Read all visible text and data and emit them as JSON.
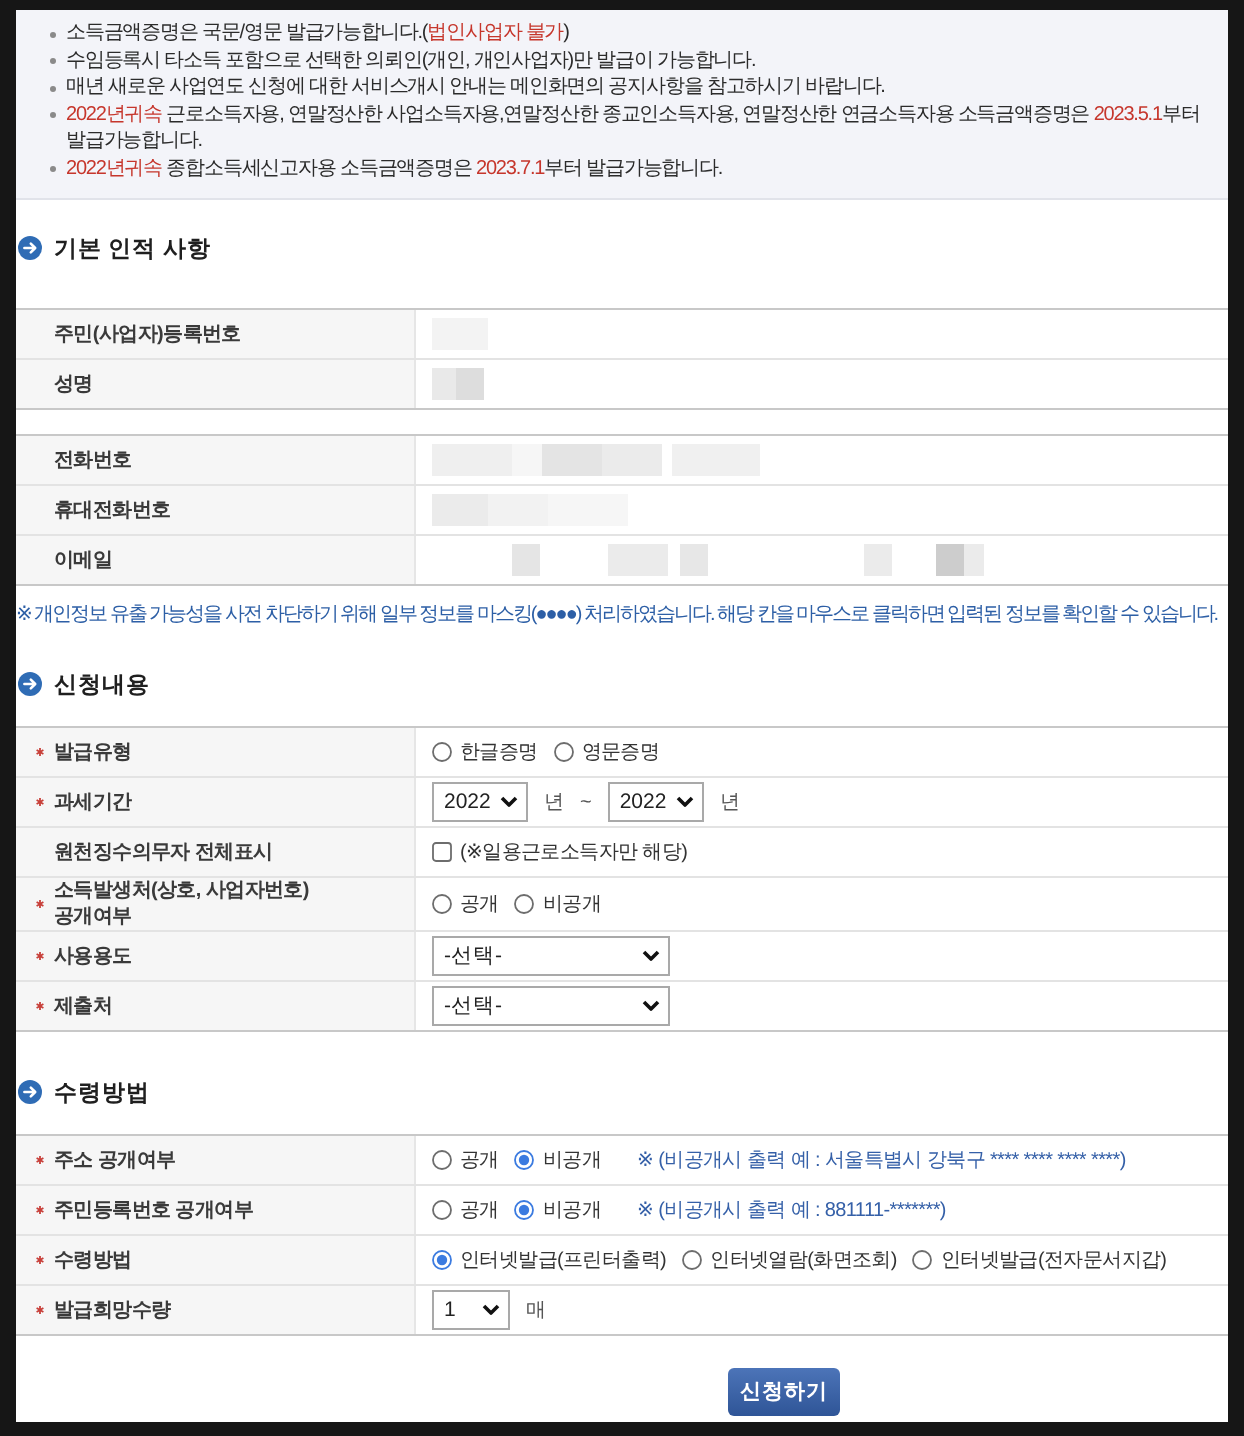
{
  "notice": {
    "items": [
      {
        "segments": [
          {
            "text": "소득금액증명은 국문/영문 발급가능합니다.(",
            "highlight": false
          },
          {
            "text": "법인사업자 불가",
            "highlight": true
          },
          {
            "text": ")",
            "highlight": false
          }
        ]
      },
      {
        "segments": [
          {
            "text": "수임등록시 타소득 포함으로 선택한 의뢰인(개인, 개인사업자)만 발급이 가능합니다.",
            "highlight": false
          }
        ]
      },
      {
        "segments": [
          {
            "text": "매년 새로운 사업연도 신청에 대한 서비스개시 안내는 메인화면의 공지사항을 참고하시기 바랍니다.",
            "highlight": false
          }
        ]
      },
      {
        "segments": [
          {
            "text": "2022년귀속",
            "highlight": true
          },
          {
            "text": " 근로소득자용, 연말정산한 사업소득자용,연말정산한 종교인소득자용, 연말정산한 연금소득자용 소득금액증명은 ",
            "highlight": false
          },
          {
            "text": "2023.5.1",
            "highlight": true
          },
          {
            "text": "부터 발급가능합니다.",
            "highlight": false
          }
        ]
      },
      {
        "segments": [
          {
            "text": "2022년귀속",
            "highlight": true
          },
          {
            "text": " 종합소득세신고자용 소득금액증명은 ",
            "highlight": false
          },
          {
            "text": "2023.7.1",
            "highlight": true
          },
          {
            "text": "부터 발급가능합니다.",
            "highlight": false
          }
        ]
      }
    ]
  },
  "personal_info": {
    "title": "기본 인적 사항",
    "groups": [
      {
        "rows": [
          {
            "label": "주민(사업자)등록번호",
            "masked": true
          },
          {
            "label": "성명",
            "masked": true
          }
        ]
      },
      {
        "rows": [
          {
            "label": "전화번호",
            "masked": true
          },
          {
            "label": "휴대전화번호",
            "masked": true
          },
          {
            "label": "이메일",
            "masked": true
          }
        ]
      }
    ],
    "note": "※ 개인정보 유출 가능성을 사전 차단하기 위해 일부 정보를 마스킹(●●●●) 처리하였습니다. 해당 칸을 마우스로 클릭하면 입력된 정보를 확인할 수 있습니다."
  },
  "form_sections": [
    {
      "title": "신청내용",
      "rows": [
        {
          "label": "발급유형",
          "required": true,
          "items": [
            {
              "kind": "radio",
              "label": "한글증명",
              "selected": false
            },
            {
              "kind": "radio",
              "label": "영문증명",
              "selected": false
            }
          ]
        },
        {
          "label": "과세기간",
          "required": true,
          "items": [
            {
              "kind": "year_select",
              "value": "2022"
            },
            {
              "kind": "unit",
              "text": "년"
            },
            {
              "kind": "separator",
              "text": "~"
            },
            {
              "kind": "year_select",
              "value": "2022"
            },
            {
              "kind": "unit",
              "text": "년"
            }
          ]
        },
        {
          "label": "원천징수의무자 전체표시",
          "required": false,
          "items": [
            {
              "kind": "checkbox",
              "label": "(※일용근로소득자만 해당)",
              "checked": false
            }
          ]
        },
        {
          "label": "소득발생처(상호, 사업자번호)\n공개여부",
          "required": true,
          "items": [
            {
              "kind": "radio",
              "label": "공개",
              "selected": false
            },
            {
              "kind": "radio",
              "label": "비공개",
              "selected": false
            }
          ]
        },
        {
          "label": "사용용도",
          "required": true,
          "items": [
            {
              "kind": "select",
              "value": "-선택-"
            }
          ]
        },
        {
          "label": "제출처",
          "required": true,
          "items": [
            {
              "kind": "select",
              "value": "-선택-"
            }
          ]
        }
      ]
    },
    {
      "title": "수령방법",
      "rows": [
        {
          "label": "주소 공개여부",
          "required": true,
          "items": [
            {
              "kind": "radio",
              "label": "공개",
              "selected": false
            },
            {
              "kind": "radio",
              "label": "비공개",
              "selected": true
            },
            {
              "kind": "note",
              "text": "※ (비공개시 출력 예 : 서울특별시 강북구 **** **** **** ****)"
            }
          ]
        },
        {
          "label": "주민등록번호 공개여부",
          "required": true,
          "items": [
            {
              "kind": "radio",
              "label": "공개",
              "selected": false
            },
            {
              "kind": "radio",
              "label": "비공개",
              "selected": true
            },
            {
              "kind": "note",
              "text": "※ (비공개시 출력 예 : 881111-*******)"
            }
          ]
        },
        {
          "label": "수령방법",
          "required": true,
          "items": [
            {
              "kind": "radio",
              "label": "인터넷발급(프린터출력)",
              "selected": true
            },
            {
              "kind": "radio",
              "label": "인터넷열람(화면조회)",
              "selected": false
            },
            {
              "kind": "radio",
              "label": "인터넷발급(전자문서지갑)",
              "selected": false
            }
          ]
        },
        {
          "label": "발급희망수량",
          "required": true,
          "items": [
            {
              "kind": "count_select",
              "value": "1"
            },
            {
              "kind": "unit",
              "text": "매"
            }
          ]
        }
      ]
    }
  ],
  "submit_button": "신청하기"
}
